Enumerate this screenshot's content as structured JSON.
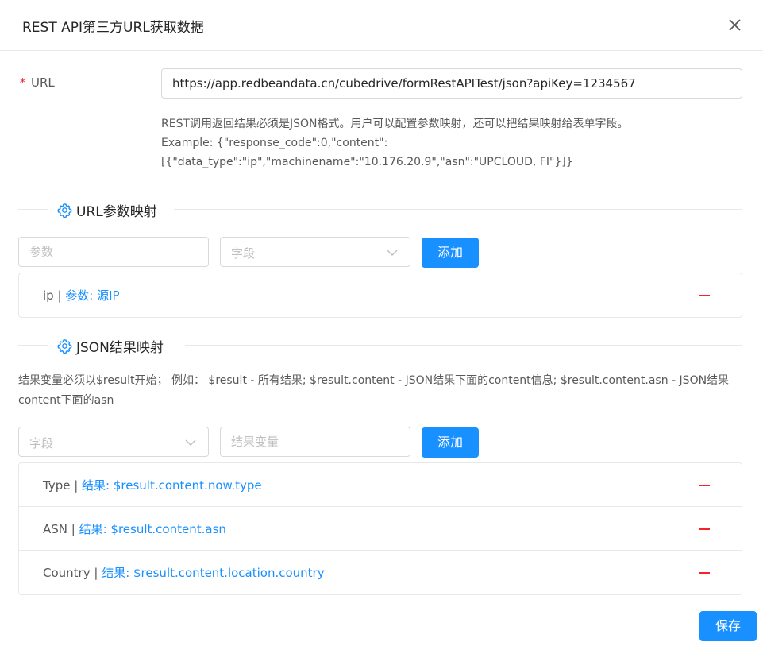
{
  "dialog": {
    "title": "REST API第三方URL获取数据"
  },
  "url_field": {
    "required_mark": "*",
    "label": "URL",
    "value": "https://app.redbeandata.cn/cubedrive/formRestAPITest/json?apiKey=1234567"
  },
  "help": {
    "line1": "REST调用返回结果必须是JSON格式。用户可以配置参数映射，还可以把结果映射给表单字段。",
    "line2": "Example: {\"response_code\":0,\"content\":",
    "line3": "[{\"data_type\":\"ip\",\"machinename\":\"10.176.20.9\",\"asn\":\"UPCLOUD, FI\"}]}"
  },
  "param_section": {
    "title": "URL参数映射",
    "param_placeholder": "参数",
    "field_placeholder": "字段",
    "add_label": "添加",
    "items": [
      {
        "name": "ip",
        "sep": " | ",
        "detail": "参数: 源IP"
      }
    ]
  },
  "json_section": {
    "title": "JSON结果映射",
    "description": "结果变量必须以$result开始； 例如： $result - 所有结果; $result.content - JSON结果下面的content信息; $result.content.asn - JSON结果content下面的asn",
    "field_placeholder": "字段",
    "result_placeholder": "结果变量",
    "add_label": "添加",
    "items": [
      {
        "name": "Type",
        "sep": " | ",
        "detail": "结果: $result.content.now.type"
      },
      {
        "name": "ASN",
        "sep": " | ",
        "detail": "结果: $result.content.asn"
      },
      {
        "name": "Country",
        "sep": " | ",
        "detail": "结果: $result.content.location.country"
      }
    ]
  },
  "footer": {
    "save_label": "保存"
  },
  "icons": {
    "close": "close-icon",
    "settings": "gear-icon",
    "dropdown": "chevron-down-icon",
    "remove": "minus-icon"
  },
  "colors": {
    "primary": "#1890ff",
    "danger": "#f5222d",
    "border": "#d9d9d9"
  }
}
